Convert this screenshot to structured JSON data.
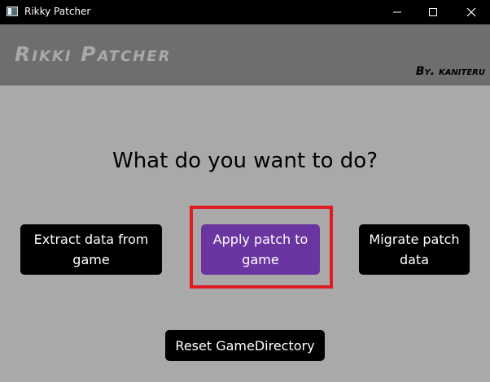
{
  "window": {
    "title": "Rikky Patcher",
    "controls": [
      "minimize-icon",
      "maximize-icon",
      "close-icon"
    ]
  },
  "header": {
    "app_name": "Rikki Patcher",
    "author": "By. kaniteru"
  },
  "main": {
    "question": "What do you want to do?",
    "buttons": {
      "extract": "Extract data from game",
      "apply": "Apply patch to game",
      "migrate": "Migrate patch data",
      "reset": "Reset GameDirectory"
    }
  },
  "colors": {
    "background": "#a9a9a9",
    "header": "#6e6e6e",
    "button": "#000000",
    "accent_button": "#6a35a0",
    "highlight": "#e01b24"
  }
}
